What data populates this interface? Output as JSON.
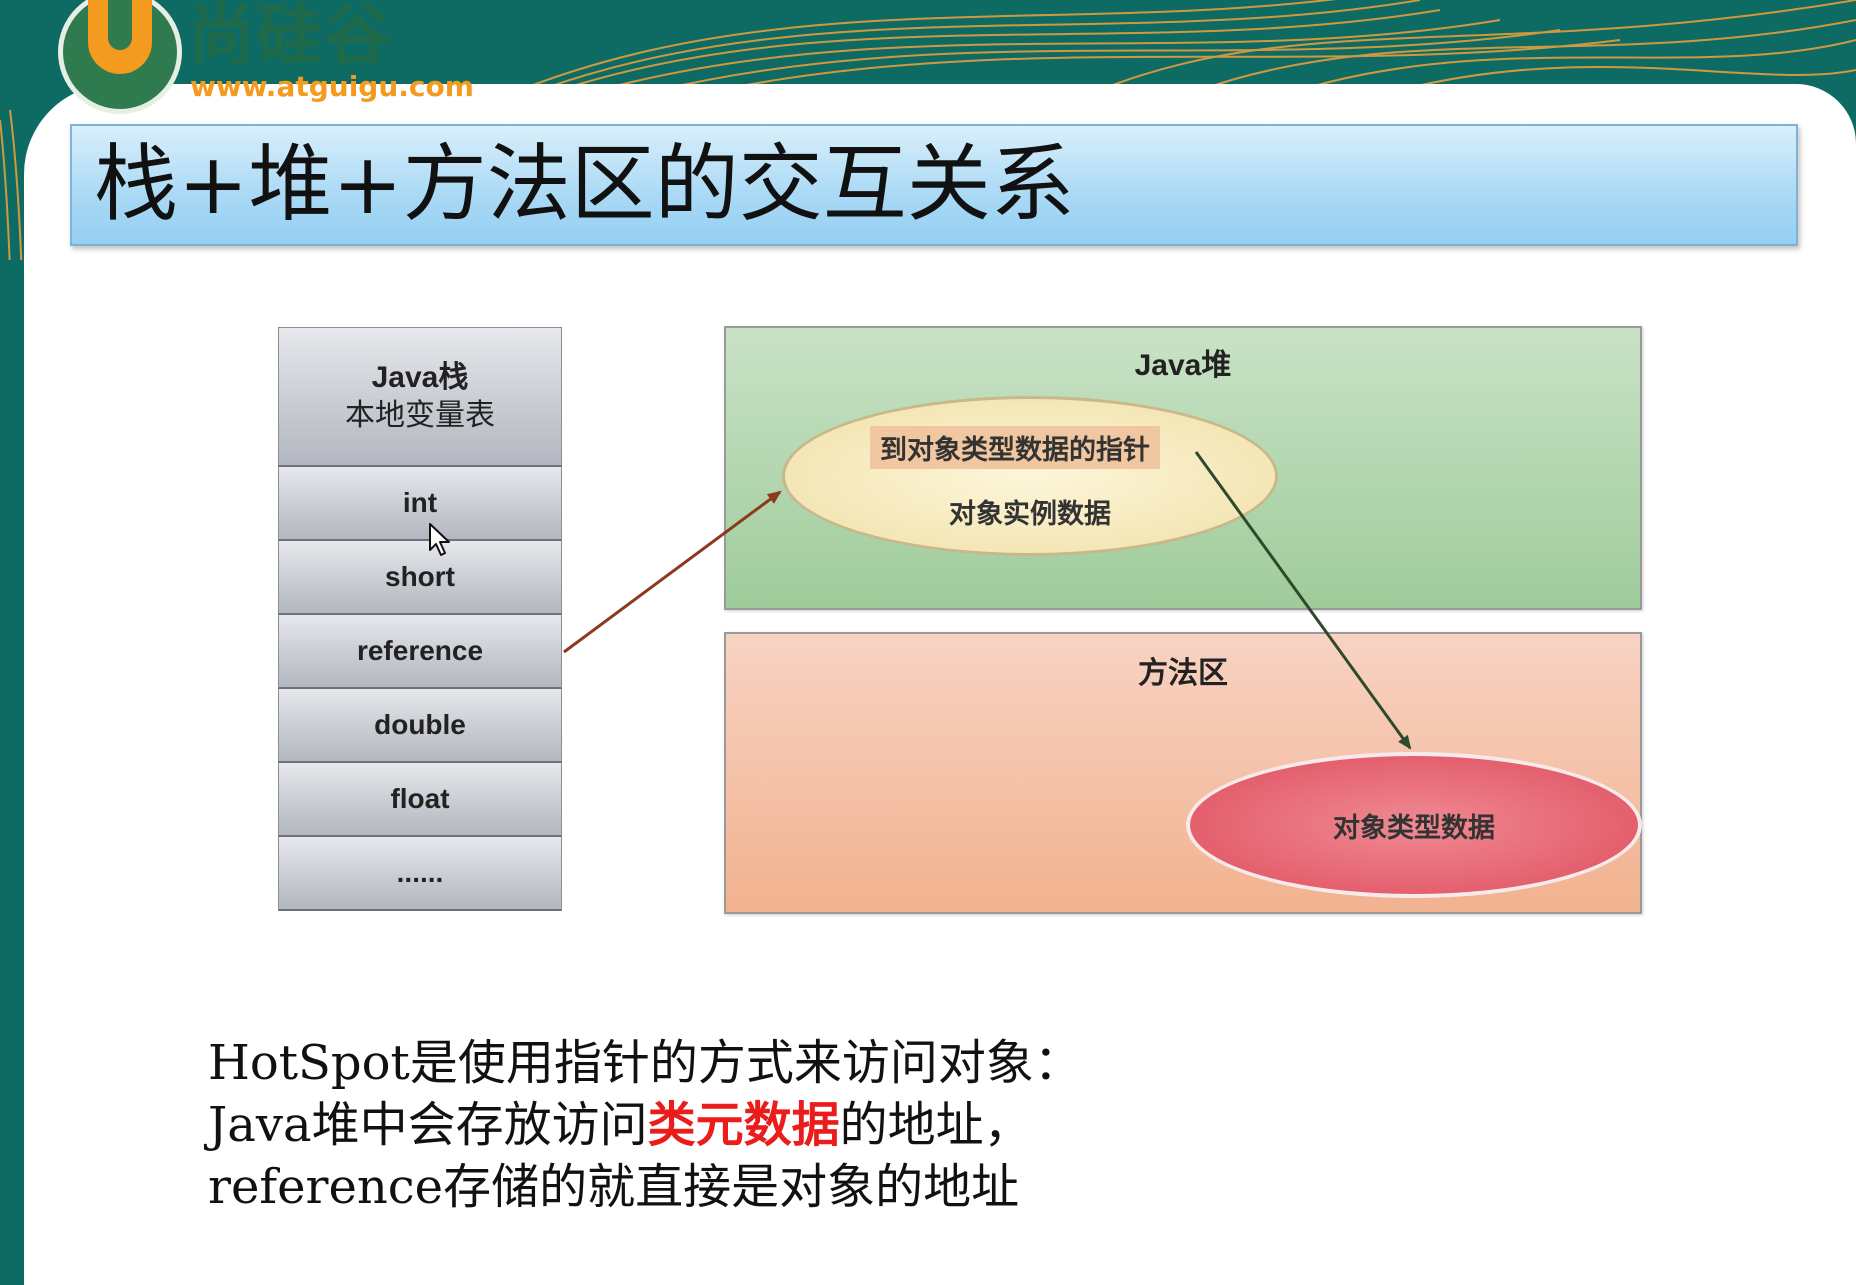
{
  "logo": {
    "name": "尚硅谷",
    "url": "www.atguigu.com"
  },
  "slide": {
    "title": "栈+堆+方法区的交互关系"
  },
  "diagram": {
    "stack": {
      "header_line1": "Java栈",
      "header_line2": "本地变量表",
      "rows": [
        "int",
        "short",
        "reference",
        "double",
        "float",
        "......"
      ]
    },
    "heap": {
      "label": "Java堆",
      "pointer_label": "到对象类型数据的指针",
      "instance_label": "对象实例数据"
    },
    "method_area": {
      "label": "方法区",
      "type_data_label": "对象类型数据"
    }
  },
  "caption": {
    "line1": "HotSpot是使用指针的方式来访问对象：",
    "line2_prefix": "Java堆中会存放访问",
    "line2_highlight": "类元数据",
    "line2_suffix": "的地址，",
    "line3": "reference存储的就直接是对象的地址"
  },
  "colors": {
    "highlight": "#ea1c1c",
    "banner": "#0e6b63",
    "logo_orange": "#f39a1f",
    "heap_green": "#9fcc9b",
    "method_orange": "#f1b28f",
    "type_ellipse": "#e35d6b"
  }
}
